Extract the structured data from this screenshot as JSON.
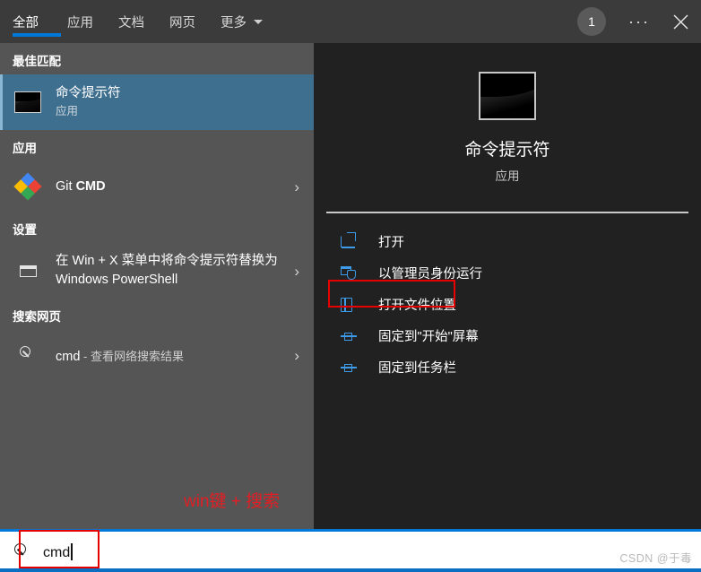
{
  "window": {
    "title": "Windows Search",
    "accent_color": "#0078d7",
    "panel_left_bg": "#555555",
    "panel_right_bg": "#212121",
    "highlight_color": "#3f6f8f",
    "annotation_color": "#e31e24"
  },
  "header": {
    "tabs": [
      {
        "label": "全部",
        "active": true
      },
      {
        "label": "应用",
        "active": false
      },
      {
        "label": "文档",
        "active": false
      },
      {
        "label": "网页",
        "active": false
      },
      {
        "label": "更多",
        "active": false,
        "has_caret": true
      }
    ],
    "avatar_badge": "1",
    "overflow_label": "···",
    "close_label": "✕"
  },
  "left": {
    "best_match": {
      "section_label": "最佳匹配",
      "title": "命令提示符",
      "subtitle": "应用",
      "icon": "cmd-window-icon"
    },
    "apps": {
      "section_label": "应用",
      "items": [
        {
          "title_prefix": "Git ",
          "title_bold": "CMD",
          "icon": "git-diamond-icon",
          "chevron": "›"
        }
      ]
    },
    "settings": {
      "section_label": "设置",
      "items": [
        {
          "title": "在 Win + X 菜单中将命令提示符替换为 Windows PowerShell",
          "icon": "window-rect-icon",
          "chevron": "›"
        }
      ]
    },
    "web": {
      "section_label": "搜索网页",
      "items": [
        {
          "query": "cmd",
          "separator": " - ",
          "description": "查看网络搜索结果",
          "icon": "search-icon",
          "chevron": "›"
        }
      ]
    }
  },
  "right": {
    "preview": {
      "title": "命令提示符",
      "subtitle": "应用",
      "icon": "cmd-window-icon"
    },
    "actions": [
      {
        "label": "打开",
        "icon": "open-icon",
        "highlighted": false
      },
      {
        "label": "以管理员身份运行",
        "icon": "shield-admin-icon",
        "highlighted": false
      },
      {
        "label": "打开文件位置",
        "icon": "folder-location-icon",
        "highlighted": true
      },
      {
        "label": "固定到\"开始\"屏幕",
        "icon": "pin-icon",
        "highlighted": false
      },
      {
        "label": "固定到任务栏",
        "icon": "pin-icon",
        "highlighted": false
      }
    ]
  },
  "annotation": {
    "text": "win键 + 搜索"
  },
  "search": {
    "value": "cmd",
    "icon": "search-icon"
  },
  "watermark": {
    "text": "CSDN @于毒"
  }
}
